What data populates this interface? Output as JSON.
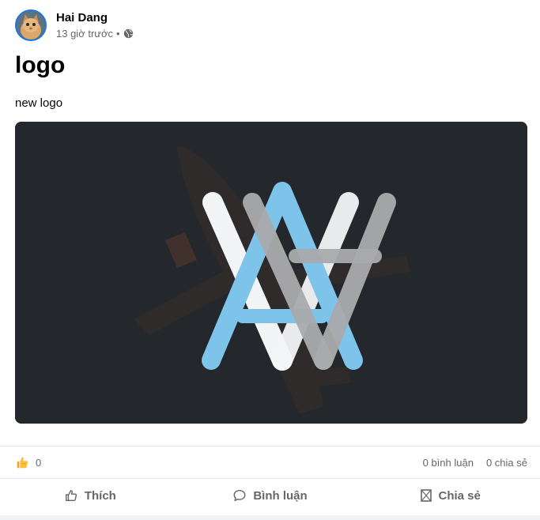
{
  "post": {
    "author": "Hai Dang",
    "time": "13 giờ trước",
    "separator": "•",
    "privacy_icon": "globe-icon",
    "title": "logo",
    "description": "new logo"
  },
  "stats": {
    "reaction_icon": "thumbs-up-emoji",
    "reaction_count": "0",
    "comments": "0 bình luận",
    "shares": "0 chia sẻ"
  },
  "actions": {
    "like": "Thích",
    "comment": "Bình luận",
    "share": "Chia sẻ"
  },
  "colors": {
    "logo_blue": "#7ec4ea",
    "logo_white": "#f3f4f6",
    "logo_gray": "#a9aaac",
    "media_bg": "#24272b",
    "accent": "#1b74e4"
  }
}
